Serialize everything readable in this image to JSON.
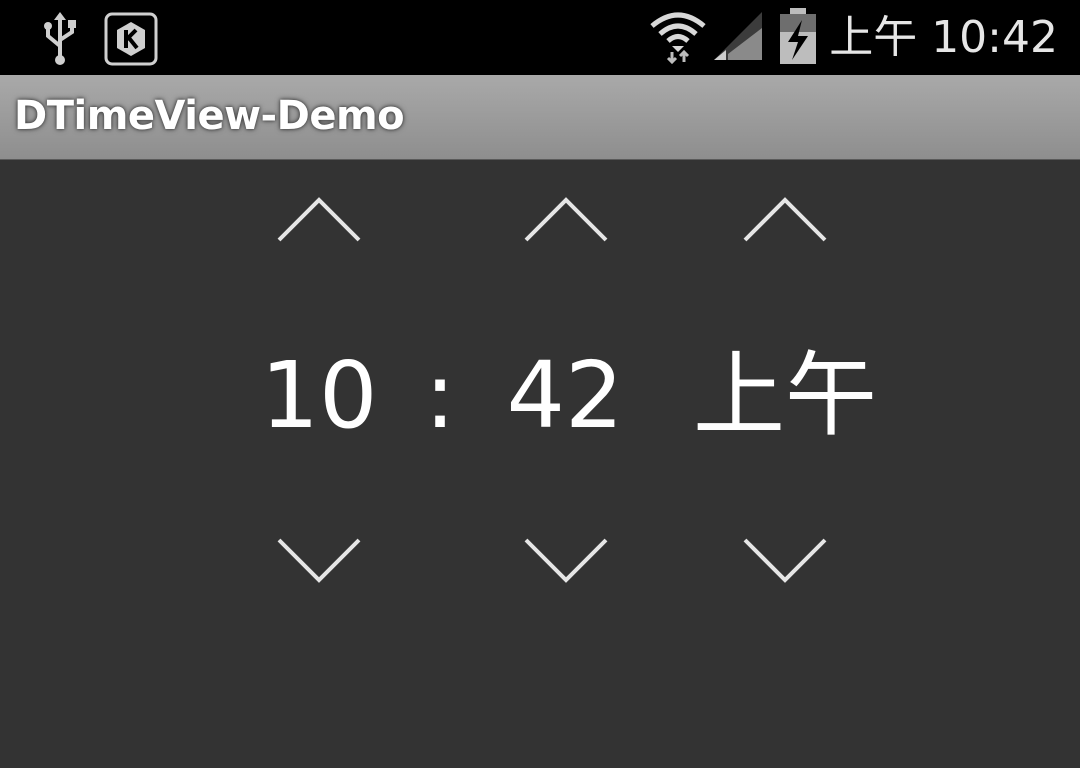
{
  "status_bar": {
    "time": "上午 10:42",
    "icons": [
      "usb-icon",
      "k-app-icon",
      "wifi-icon",
      "signal-icon",
      "battery-charging-icon"
    ]
  },
  "action_bar": {
    "title": "DTimeView-Demo"
  },
  "time_picker": {
    "hour": "10",
    "separator": ":",
    "minute": "42",
    "ampm": "上午"
  },
  "colors": {
    "status_bar_bg": "#000000",
    "action_bar_bg": "#9a9a9a",
    "content_bg": "#333333",
    "text": "#ffffff"
  }
}
